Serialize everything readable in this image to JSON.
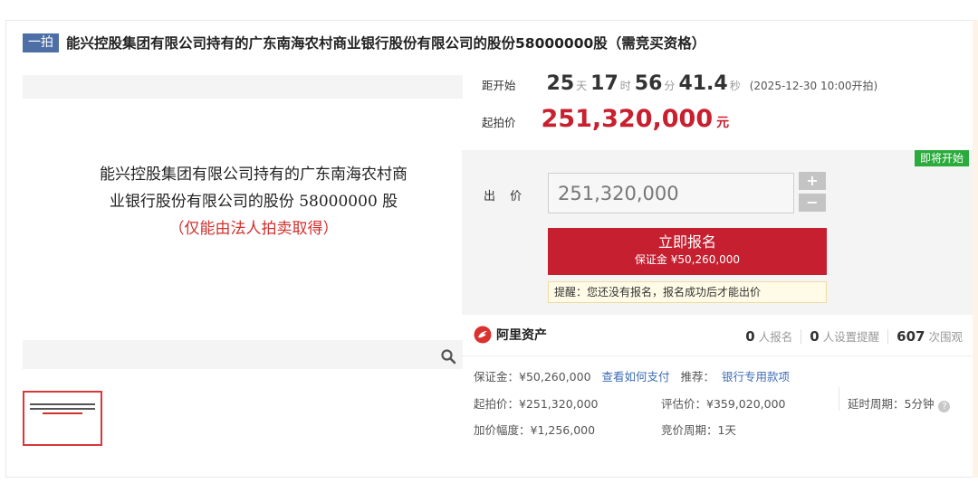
{
  "header": {
    "badge": "一拍",
    "title": "能兴控股集团有限公司持有的广东南海农村商业银行股份有限公司的股份58000000股（需竞买资格）"
  },
  "preview": {
    "line1": "能兴控股集团有限公司持有的广东南海农村商",
    "line2": "业银行股份有限公司的股份 58000000 股",
    "line3": "（仅能由法人拍卖取得）"
  },
  "countdown": {
    "label": "距开始",
    "days": "25",
    "days_unit": "天",
    "hours": "17",
    "hours_unit": "时",
    "minutes": "56",
    "minutes_unit": "分",
    "seconds": "41.4",
    "seconds_unit": "秒",
    "start_note": "(2025-12-30 10:00开拍)"
  },
  "start_price": {
    "label": "起拍价",
    "value": "251,320,000",
    "unit": "元"
  },
  "bid": {
    "status_tag": "即将开始",
    "label": "出 价",
    "input_value": "251,320,000",
    "plus": "+",
    "minus": "−",
    "signup_label": "立即报名",
    "signup_deposit": "保证金 ¥50,260,000",
    "tip": "提醒：您还没有报名，报名成功后才能出价"
  },
  "brand": {
    "name": "阿里资产"
  },
  "stats": {
    "signups": "0",
    "signups_unit": "人报名",
    "reminders": "0",
    "reminders_unit": "人设置提醒",
    "views": "607",
    "views_unit": "次围观"
  },
  "details": {
    "deposit": "保证金：¥50,260,000",
    "how_to_pay": "查看如何支付",
    "recommend_label": "推荐：",
    "recommend_link": "银行专用款项",
    "start_price": "起拍价：¥251,320,000",
    "appraisal": "评估价：¥359,020,000",
    "delay": "延时周期：5分钟",
    "increment": "加价幅度：¥1,256,000",
    "cycle": "竞价周期：1天"
  },
  "colors": {
    "accent_red": "#c51f30",
    "badge_blue": "#4d6fa6",
    "status_green": "#2bab3c",
    "link_blue": "#3d6db5"
  }
}
